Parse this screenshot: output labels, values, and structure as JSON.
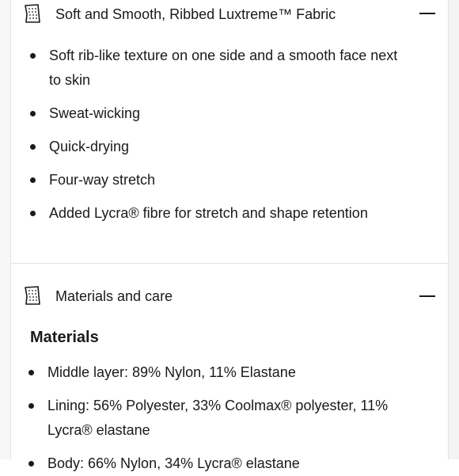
{
  "sections": [
    {
      "icon": "fabric-swatch-icon",
      "title": "Soft and Smooth, Ribbed Luxtreme™ Fabric",
      "toggle": "collapse",
      "bullets": [
        "Soft rib-like texture on one side and a smooth face next to skin",
        "Sweat-wicking",
        "Quick-drying",
        "Four-way stretch",
        "Added Lycra® fibre for stretch and shape retention"
      ]
    },
    {
      "icon": "fabric-swatch-icon",
      "title": "Materials and care",
      "toggle": "collapse",
      "heading": "Materials",
      "bullets": [
        "Middle layer: 89% Nylon, 11% Elastane",
        "Lining: 56% Polyester, 33% Coolmax® polyester, 11% Lycra® elastane",
        "Body: 66% Nylon, 34% Lycra® elastane"
      ]
    }
  ],
  "colors": {
    "text": "#1a1a1a",
    "border": "#e2e2e2",
    "background": "#ffffff"
  }
}
